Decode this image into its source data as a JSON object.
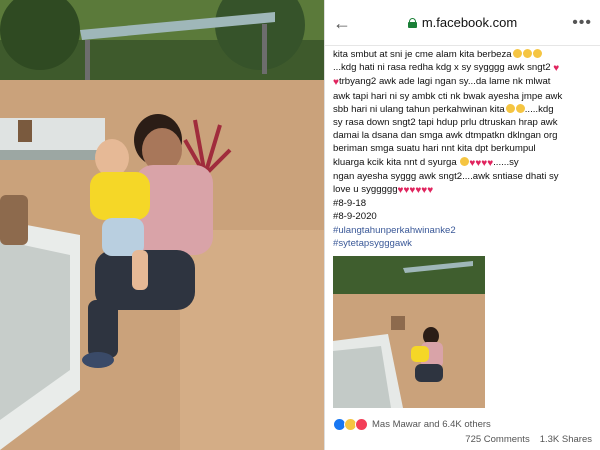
{
  "browser": {
    "url": "m.facebook.com"
  },
  "post": {
    "lines": [
      "kita smbut at sni je cme alam kita berbeza",
      "...kdg hati ni rasa redha kdg x sy sygggg awk sngt2",
      "trbyang2 awk ade lagi ngan sy...da lame nk mlwat",
      "awk tapi hari ni sy ambk cti nk bwak ayesha jmpe awk",
      "sbb hari ni ulang tahun perkahwinan kita",
      ".....kdg",
      "sy rasa down sngt2 tapi hdup prlu dtruskan hrap awk",
      "damai la dsana dan smga awk dtmpatkn dklngan org",
      "beriman smga suatu hari nnt kita dpt berkumpul",
      "kluarga kcik kita nnt d syurga",
      "......sy",
      "ngan ayesha syggg awk sngt2....awk sntiase dhati sy",
      "love u syggggg",
      "#8-9-18",
      "#8-9-2020"
    ],
    "hashtags": [
      "#ulangtahunperkahwinanke2",
      "#sytetapsygggawk"
    ]
  },
  "engagement": {
    "names": "Mas Mawar and 6.4K others",
    "comments": "725 Comments",
    "shares": "1.3K Shares"
  },
  "icons": {
    "back": "arrow-left-icon",
    "lock": "lock-icon",
    "more": "more-dots-icon",
    "reactions": [
      "like-icon",
      "sad-icon",
      "love-icon"
    ]
  },
  "colors": {
    "hashtag": "#3b5998",
    "lock": "#1a7f37",
    "like": "#1877f2",
    "love": "#f33e58"
  }
}
